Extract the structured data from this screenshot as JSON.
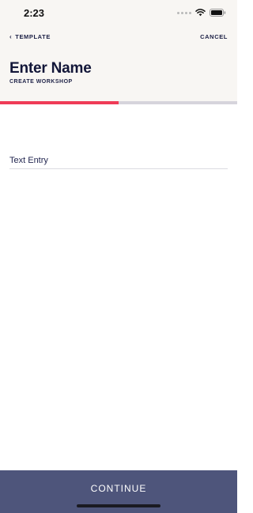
{
  "status_bar": {
    "time": "2:23",
    "icons": [
      "signal-dots-icon",
      "wifi-icon",
      "battery-icon"
    ]
  },
  "nav": {
    "back_label": "TEMPLATE",
    "back_icon": "chevron-left-icon",
    "cancel_label": "CANCEL"
  },
  "header": {
    "title": "Enter Name",
    "subtitle": "CREATE WORKSHOP"
  },
  "progress": {
    "fraction": 0.5,
    "fill_color": "#ef3b57",
    "track_color": "#d6d4dc"
  },
  "form": {
    "name_input": {
      "value": "",
      "placeholder": "Text Entry"
    }
  },
  "footer": {
    "continue_label": "CONTINUE",
    "button_color": "#4e557b"
  }
}
